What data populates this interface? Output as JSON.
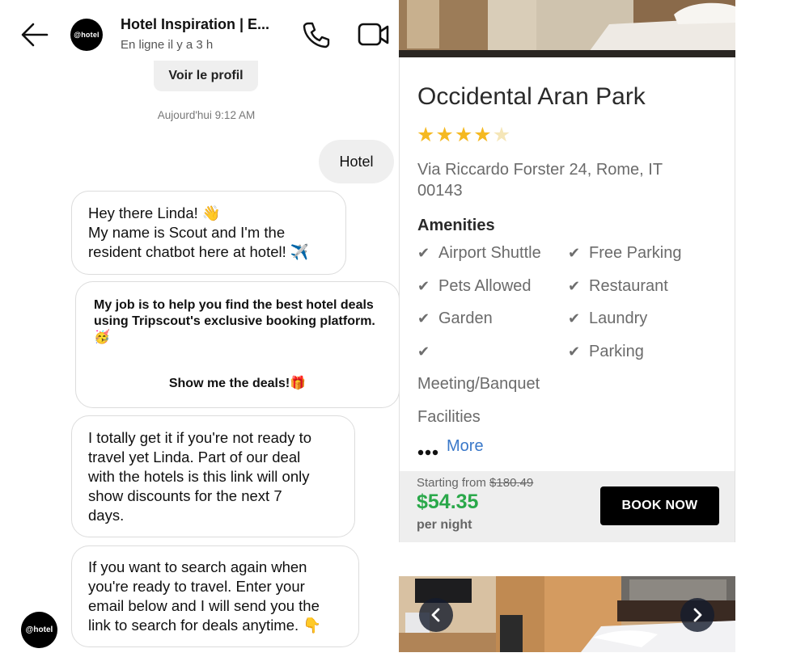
{
  "header": {
    "avatar_text": "@hotel",
    "title": "Hotel Inspiration | E...",
    "status": "En ligne il y a 3 h"
  },
  "chat": {
    "profile_button": "Voir le profil",
    "timestamp": "Aujourd'hui 9:12 AM",
    "user_message": "Hotel",
    "bot_avatar_text": "@hotel",
    "bot_messages": [
      {
        "lines": [
          "Hey there Linda! 👋",
          "My name is Scout and I'm the",
          "resident chatbot here at hotel! ✈️"
        ]
      },
      {
        "text": "My job is to help you find the best hotel deals using Tripscout's exclusive booking platform. 🥳",
        "button": "Show me the deals!🎁"
      },
      {
        "lines": [
          "I totally get it if you're not ready to",
          "travel yet Linda. Part of our deal",
          "with the hotels is this link will only",
          "show discounts for the next 7",
          "days."
        ]
      },
      {
        "lines": [
          "If you want to search again when",
          "you're ready to travel. Enter your",
          "email below and I will send you the",
          "link to search for deals anytime. 👇"
        ]
      }
    ]
  },
  "hotel_card": {
    "name": "Occidental Aran Park",
    "rating": 4,
    "rating_max": 5,
    "address": "Via Riccardo Forster 24, Rome, IT 00143",
    "amenities_title": "Amenities",
    "amenities_left": [
      "Airport Shuttle",
      "Pets Allowed",
      "Garden",
      "",
      "Meeting/Banquet",
      "Facilities"
    ],
    "amenities_right": [
      "Free Parking",
      "Restaurant",
      "Laundry",
      "Parking"
    ],
    "more_label": "More",
    "starting_from": "Starting from",
    "old_price": "$180.49",
    "price": "$54.35",
    "per_night": "per night",
    "book_button": "BOOK NOW"
  },
  "colors": {
    "star": "#f5b921",
    "price_green": "#2aa84a",
    "link_blue": "#3a78c9",
    "bubble_gray": "#efefef"
  }
}
